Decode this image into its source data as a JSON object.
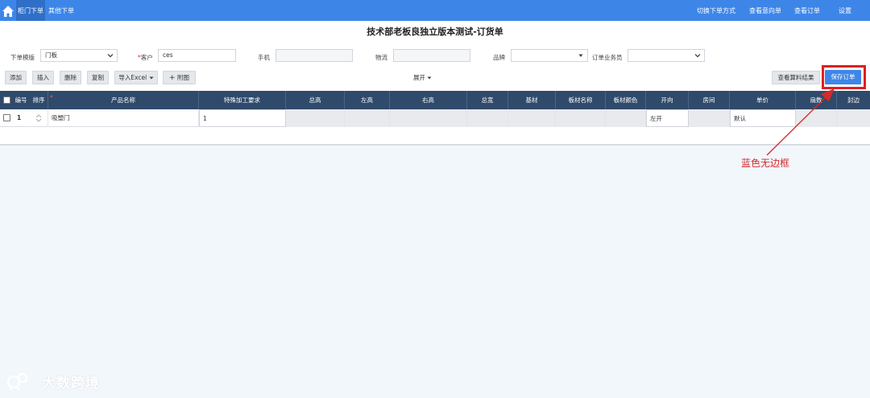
{
  "topbar": {
    "tabs": [
      {
        "label": "柜门下单"
      },
      {
        "label": "其他下单"
      }
    ],
    "links": [
      {
        "label": "切换下单方式"
      },
      {
        "label": "查看意向单"
      },
      {
        "label": "查看订单"
      },
      {
        "label": "设置"
      }
    ]
  },
  "page_title": "技术部老板良独立版本测试-订货单",
  "form": {
    "template_label": "下单模版",
    "template_value": "门板",
    "customer_label": "客户",
    "customer_required": "*",
    "customer_value": "ces",
    "phone_label": "手机",
    "phone_value": "",
    "logistics_label": "物流",
    "logistics_value": "",
    "brand_label": "品牌",
    "brand_value": "",
    "salesman_label": "订单业务员",
    "salesman_value": ""
  },
  "toolbar": {
    "add": "添加",
    "insert": "插入",
    "delete": "删除",
    "copy": "复制",
    "import_excel": "导入Excel",
    "attach": "附图",
    "attach_plus": "+",
    "expand": "展开",
    "view_calc": "查看算料结果",
    "save_order": "保存订单"
  },
  "table": {
    "headers": [
      "编号",
      "排序",
      "产品名称",
      "特殊加工要求",
      "总高",
      "左高",
      "右高",
      "总宽",
      "基材",
      "板材名称",
      "板材颜色",
      "开向",
      "房间",
      "单价",
      "扇数",
      "封边"
    ],
    "required_mark": "*",
    "rows": [
      {
        "no": "1",
        "product": "吸塑门",
        "special": "1",
        "open_dir": "左开",
        "price": "默认"
      }
    ]
  },
  "annotation": {
    "text": "蓝色无边框"
  },
  "watermark": {
    "text": "大数跨境"
  },
  "colors": {
    "accent": "#3d86e8",
    "table_header": "#2f4a6b",
    "annotation": "#d42b2b"
  }
}
